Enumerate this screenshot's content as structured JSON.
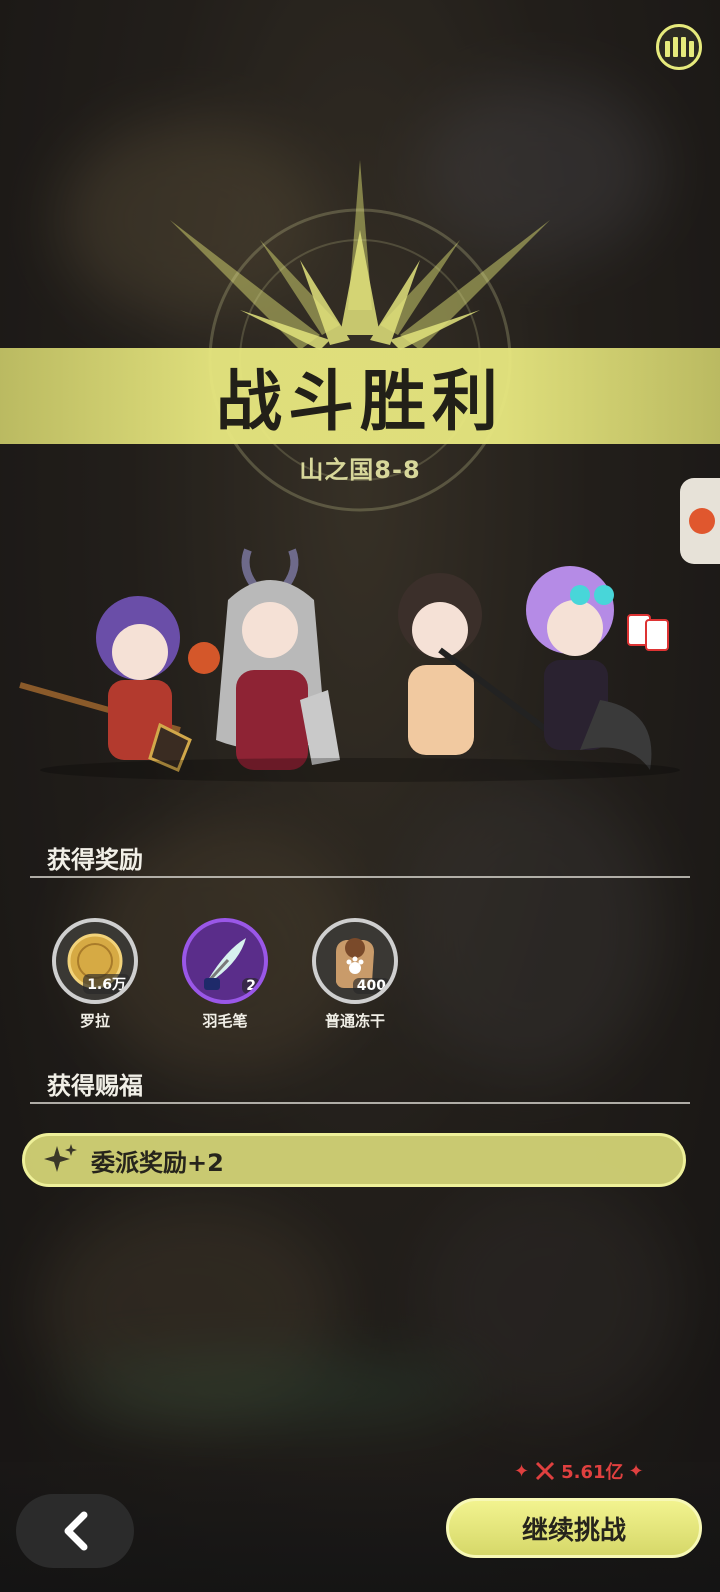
{
  "header": {
    "stats_icon": "stats-book-icon"
  },
  "result": {
    "title": "战斗胜利",
    "stage": "山之国8-8"
  },
  "team": [
    {
      "name": "character-1",
      "hair": "#6a4ea8",
      "outfit": "#b33a2e"
    },
    {
      "name": "character-2",
      "hair": "#b9b9b9",
      "outfit": "#8e2334"
    },
    {
      "name": "character-3",
      "hair": "#3b2f2a",
      "outfit": "#f1c9a0"
    },
    {
      "name": "character-4",
      "hair": "#b58be6",
      "outfit": "#2a2230"
    }
  ],
  "rewards": {
    "title": "获得奖励",
    "items": [
      {
        "label": "罗拉",
        "count": "1.6万",
        "icon": "coin-icon",
        "rarity": "normal"
      },
      {
        "label": "羽毛笔",
        "count": "2",
        "icon": "quill-icon",
        "rarity": "epic"
      },
      {
        "label": "普通冻干",
        "count": "400",
        "icon": "food-bag-icon",
        "rarity": "normal"
      }
    ]
  },
  "blessings": {
    "title": "获得赐福",
    "items": [
      {
        "label": "委派奖励+2",
        "icon": "sparkle-icon"
      }
    ]
  },
  "footer": {
    "power_value": "5.61亿",
    "continue_label": "继续挑战",
    "back_icon": "chevron-left-icon"
  },
  "colors": {
    "accent": "#e6ea7c",
    "power": "#e0403f",
    "epic": "#9a57e8"
  }
}
